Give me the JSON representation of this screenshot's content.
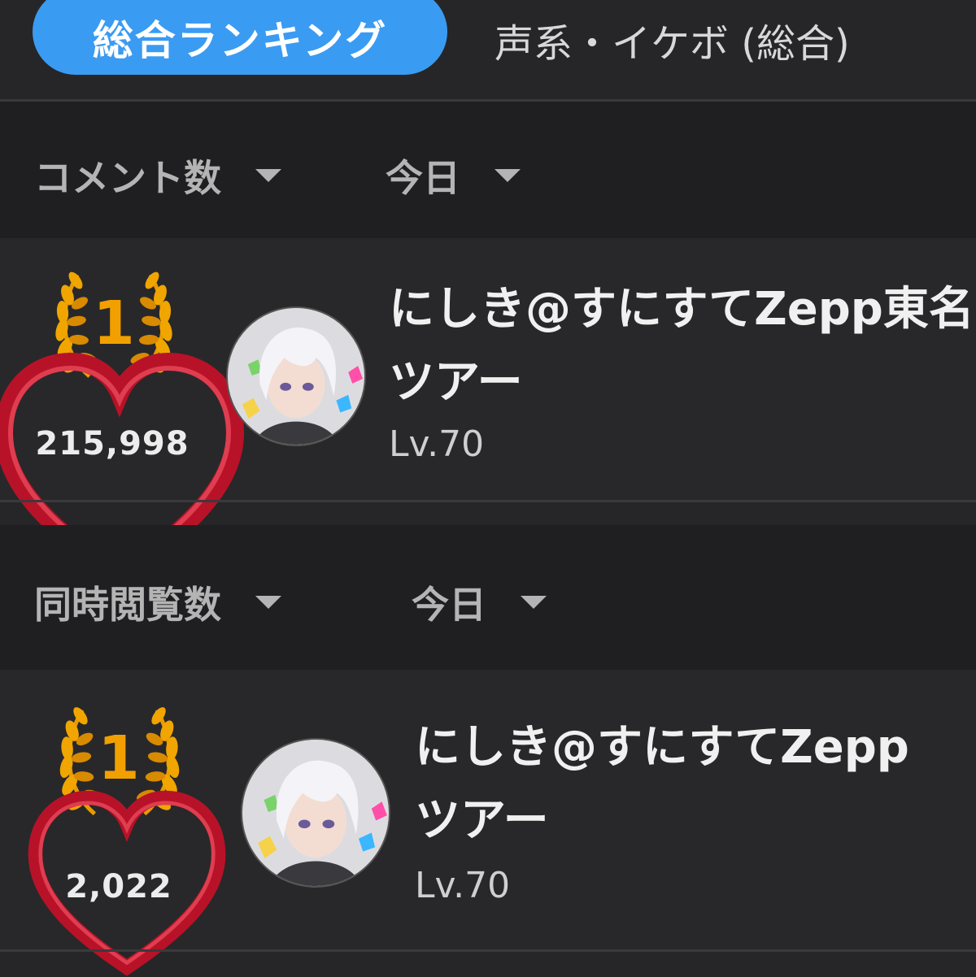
{
  "tabs": {
    "active_label": "総合ランキング",
    "inactive_label": "声系・イケボ (総合)"
  },
  "sections": [
    {
      "metric_label": "コメント数",
      "period_label": "今日",
      "entry": {
        "rank": "1",
        "count": "215,998",
        "name_line1": "にしき@すにすてZepp東名",
        "name_line2": "ツアー",
        "level": "Lv.70"
      }
    },
    {
      "metric_label": "同時閲覧数",
      "period_label": "今日",
      "entry": {
        "rank": "1",
        "count": "2,022",
        "name_line1": "にしき@すにすてZepp",
        "name_line2": "ツアー",
        "level": "Lv.70"
      }
    }
  ],
  "icons": {
    "dropdown": "chevron-down-icon",
    "laurel": "laurel-wreath-icon",
    "heart": "heart-icon",
    "avatar": "user-avatar"
  },
  "colors": {
    "accent": "#3a9bf2",
    "rank_gold": "#f2a000",
    "heart_red": "#d8283c",
    "background": "#262628"
  }
}
